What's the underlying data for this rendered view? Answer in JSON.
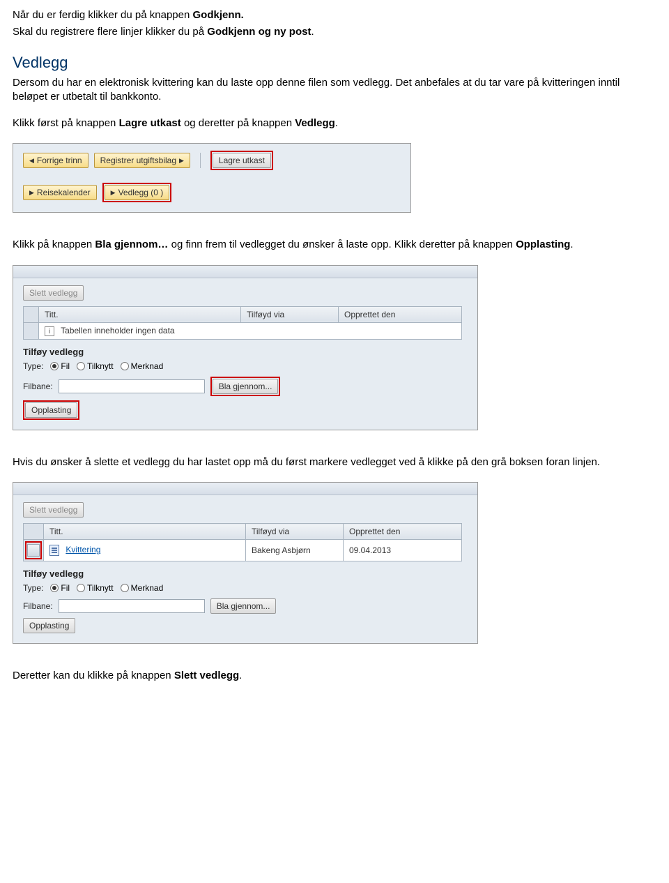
{
  "intro": {
    "line1_a": "Når du er ferdig klikker du på knappen ",
    "line1_b": "Godkjenn.",
    "line2_a": "Skal du registrere flere linjer klikker du på ",
    "line2_b": "Godkjenn og ny post",
    "line2_c": "."
  },
  "vedlegg_heading": "Vedlegg",
  "vedlegg_para": "Dersom du har en elektronisk kvittering kan du laste opp denne filen som vedlegg. Det anbefales at du tar vare på kvitteringen inntil beløpet er utbetalt til bankkonto.",
  "vedlegg_instruction_a": "Klikk først på knappen ",
  "vedlegg_instruction_b": "Lagre utkast",
  "vedlegg_instruction_c": " og deretter på knappen ",
  "vedlegg_instruction_d": "Vedlegg",
  "vedlegg_instruction_e": ".",
  "shot1": {
    "prev": "Forrige trinn",
    "reg": "Registrer utgiftsbilag",
    "lagre": "Lagre utkast",
    "reisekalender": "Reisekalender",
    "vedlegg": "Vedlegg (0 )"
  },
  "mid_para_a": "Klikk på knappen ",
  "mid_para_b": "Bla gjennom…",
  "mid_para_c": " og finn frem til vedlegget du ønsker å laste opp. Klikk deretter på knappen ",
  "mid_para_d": "Opplasting",
  "mid_para_e": ".",
  "shot2": {
    "slett": "Slett vedlegg",
    "col_titt": "Titt.",
    "col_tilfoyd": "Tilføyd via",
    "col_opprettet": "Opprettet den",
    "no_data": "Tabellen inneholder ingen data",
    "tilfoy_heading": "Tilføy vedlegg",
    "type_label": "Type:",
    "radio_fil": "Fil",
    "radio_tilknytt": "Tilknytt",
    "radio_merknad": "Merknad",
    "filbane_label": "Filbane:",
    "bla": "Bla gjennom...",
    "opplasting": "Opplasting"
  },
  "after2_para": "Hvis du ønsker å slette et vedlegg du har lastet opp må du først markere vedlegget ved å klikke på den grå boksen foran linjen.",
  "shot3": {
    "slett": "Slett vedlegg",
    "col_titt": "Titt.",
    "col_tilfoyd": "Tilføyd via",
    "col_opprettet": "Opprettet den",
    "row_title": "Kvittering",
    "row_via": "Bakeng Asbjørn",
    "row_date": "09.04.2013",
    "tilfoy_heading": "Tilføy vedlegg",
    "type_label": "Type:",
    "radio_fil": "Fil",
    "radio_tilknytt": "Tilknytt",
    "radio_merknad": "Merknad",
    "filbane_label": "Filbane:",
    "bla": "Bla gjennom...",
    "opplasting": "Opplasting"
  },
  "final_a": "Deretter kan du klikke på knappen ",
  "final_b": "Slett vedlegg",
  "final_c": "."
}
